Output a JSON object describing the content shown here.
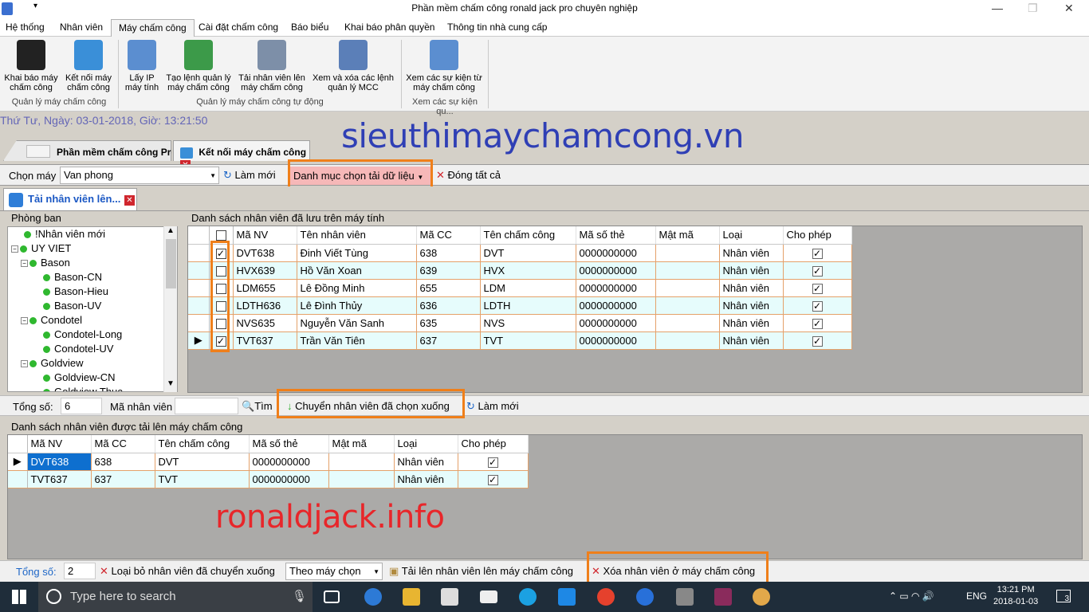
{
  "window": {
    "title": "Phần mềm chấm công ronald jack pro chuyên nghiệp"
  },
  "menu": {
    "tabs": [
      "Hệ thống",
      "Nhân viên",
      "Máy chấm công",
      "Cài đặt chấm công",
      "Báo biểu",
      "Khai báo  phân quyền",
      "Thông tin nhà cung cấp"
    ]
  },
  "ribbon": {
    "buttons": [
      {
        "label1": "Khai báo máy",
        "label2": "chấm công"
      },
      {
        "label1": "Kết nối máy",
        "label2": "chấm công"
      },
      {
        "label1": "Lấy IP",
        "label2": "máy tính"
      },
      {
        "label1": "Tạo lệnh quản lý",
        "label2": "máy chấm công"
      },
      {
        "label1": "Tải nhân viên lên",
        "label2": "máy chấm công"
      },
      {
        "label1": "Xem và xóa các lệnh",
        "label2": "quản lý MCC"
      },
      {
        "label1": "Xem các sự kiện từ",
        "label2": "máy chấm công"
      }
    ],
    "groups": [
      "Quản lý máy chấm công",
      "Quản lý máy chấm công tự động",
      "Xem các sự kiện qu..."
    ]
  },
  "dateline": "Thứ Tư, Ngày: 03-01-2018, Giờ: 13:21:50",
  "watermark_top": "sieuthimaychamcong.vn",
  "watermark_bottom": "ronaldjack.info",
  "doctabs": [
    "Phần mềm chấm công Pro",
    "Kết nối máy chấm công"
  ],
  "toolbar": {
    "chon_may_label": "Chọn máy",
    "chon_may_value": "Van phong",
    "lam_moi": "Làm mới",
    "danh_muc": "Danh mục chọn tải dữ liệu",
    "dong_tat_ca": "Đóng tất cả"
  },
  "panel_tab": "Tải nhân viên lên...",
  "phong_ban": {
    "title": "Phòng ban",
    "nodes": [
      {
        "text": "!Nhân viên mới",
        "level": 1
      },
      {
        "text": "UY VIET",
        "level": 0
      },
      {
        "text": "Bason",
        "level": 1
      },
      {
        "text": "Bason-CN",
        "level": 2
      },
      {
        "text": "Bason-Hieu",
        "level": 2
      },
      {
        "text": "Bason-UV",
        "level": 2
      },
      {
        "text": "Condotel",
        "level": 1
      },
      {
        "text": "Condotel-Long",
        "level": 2
      },
      {
        "text": "Condotel-UV",
        "level": 2
      },
      {
        "text": "Goldview",
        "level": 1
      },
      {
        "text": "Goldview-CN",
        "level": 2
      },
      {
        "text": "Goldview Thuc",
        "level": 2
      }
    ]
  },
  "grid1": {
    "title": "Danh sách nhân viên đã lưu trên máy tính",
    "columns": [
      "Mã NV",
      "Tên nhân viên",
      "Mã CC",
      "Tên chấm công",
      "Mã số thẻ",
      "Mật mã",
      "Loại",
      "Cho phép"
    ],
    "rows": [
      {
        "checked": true,
        "ma_nv": "DVT638",
        "ten": "Đinh Viết Tùng",
        "ma_cc": "638",
        "ten_cc": "DVT",
        "the": "0000000000",
        "mat_ma": "",
        "loai": "Nhân viên"
      },
      {
        "checked": false,
        "ma_nv": "HVX639",
        "ten": "Hồ Văn Xoan",
        "ma_cc": "639",
        "ten_cc": "HVX",
        "the": "0000000000",
        "mat_ma": "",
        "loai": "Nhân viên"
      },
      {
        "checked": false,
        "ma_nv": "LDM655",
        "ten": "Lê Đồng Minh",
        "ma_cc": "655",
        "ten_cc": "LDM",
        "the": "0000000000",
        "mat_ma": "",
        "loai": "Nhân viên"
      },
      {
        "checked": false,
        "ma_nv": "LDTH636",
        "ten": "Lê Đình Thủy",
        "ma_cc": "636",
        "ten_cc": "LDTH",
        "the": "0000000000",
        "mat_ma": "",
        "loai": "Nhân viên"
      },
      {
        "checked": false,
        "ma_nv": "NVS635",
        "ten": "Nguyễn Văn Sanh",
        "ma_cc": "635",
        "ten_cc": "NVS",
        "the": "0000000000",
        "mat_ma": "",
        "loai": "Nhân viên"
      },
      {
        "checked": true,
        "ma_nv": "TVT637",
        "ten": "Trần Văn Tiên",
        "ma_cc": "637",
        "ten_cc": "TVT",
        "the": "0000000000",
        "mat_ma": "",
        "loai": "Nhân viên"
      }
    ]
  },
  "midbar": {
    "tong_so_label": "Tổng số:",
    "tong_so": "6",
    "ma_nv_label": "Mã nhân viên",
    "tim": "Tìm",
    "chuyen": "Chuyển nhân viên đã chọn xuống",
    "lam_moi": "Làm mới"
  },
  "grid2": {
    "title": "Danh sách nhân viên được tải lên máy chấm công",
    "columns": [
      "Mã NV",
      "Mã CC",
      "Tên chấm công",
      "Mã số thẻ",
      "Mật mã",
      "Loại",
      "Cho phép"
    ],
    "rows": [
      {
        "ma_nv": "DVT638",
        "ma_cc": "638",
        "ten_cc": "DVT",
        "the": "0000000000",
        "mat_ma": "",
        "loai": "Nhân viên"
      },
      {
        "ma_nv": "TVT637",
        "ma_cc": "637",
        "ten_cc": "TVT",
        "the": "0000000000",
        "mat_ma": "",
        "loai": "Nhân viên"
      }
    ]
  },
  "botbar": {
    "tong_so_label": "Tổng số:",
    "tong_so": "2",
    "loai_bo": "Loại bỏ nhân viên đã chuyển xuống",
    "theo_may": "Theo máy chọn",
    "tai_len": "Tải lên  nhân viên lên máy chấm công",
    "xoa": "Xóa nhân viên  ở máy chấm công"
  },
  "taskbar": {
    "search_placeholder": "Type here to search",
    "lang": "ENG",
    "time": "13:21 PM",
    "date": "2018-01-03",
    "notif": "3"
  }
}
